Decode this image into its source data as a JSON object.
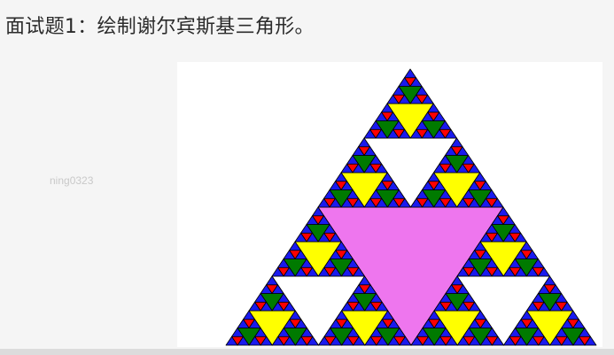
{
  "question": {
    "title": "面试题1：绘制谢尔宾斯基三角形。"
  },
  "watermark": {
    "text": "ning0323"
  },
  "sierpinski": {
    "recursion_depth": 5,
    "depth_colors": [
      "#ee76ee",
      "#ffffff",
      "#ffff00",
      "#007a00",
      "#ff0000"
    ],
    "corner_fill": "#1a1aee",
    "outline": "#000000"
  }
}
